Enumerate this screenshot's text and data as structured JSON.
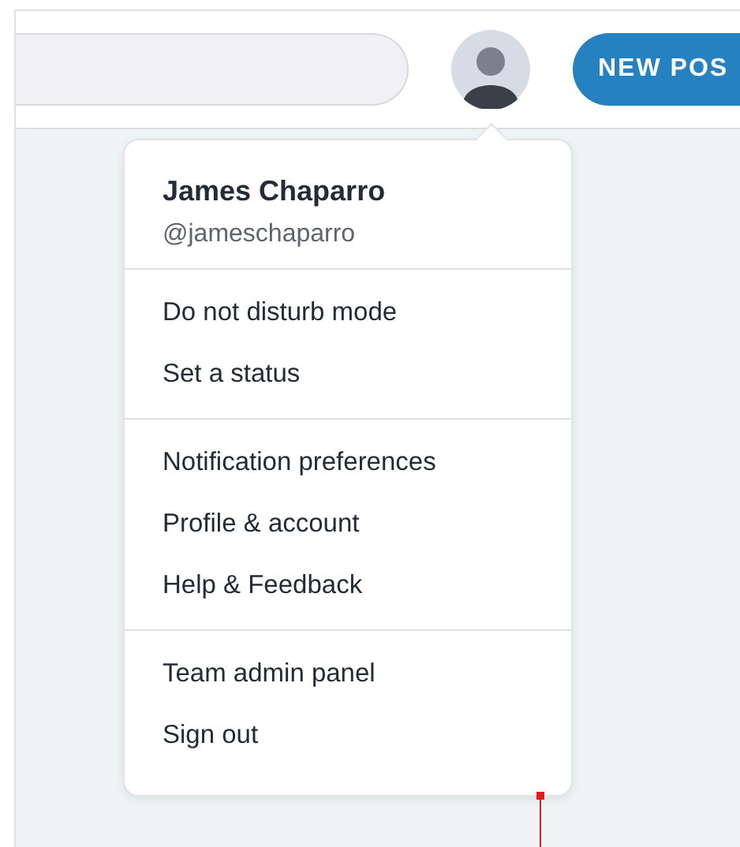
{
  "header": {
    "new_post_button": "NEW POS"
  },
  "user_menu": {
    "name": "James Chaparro",
    "handle": "@jameschaparro",
    "sections": [
      {
        "items": [
          "Do not disturb mode",
          "Set a status"
        ]
      },
      {
        "items": [
          "Notification preferences",
          "Profile & account",
          "Help & Feedback"
        ]
      },
      {
        "items": [
          "Team admin panel",
          "Sign out"
        ]
      }
    ]
  }
}
